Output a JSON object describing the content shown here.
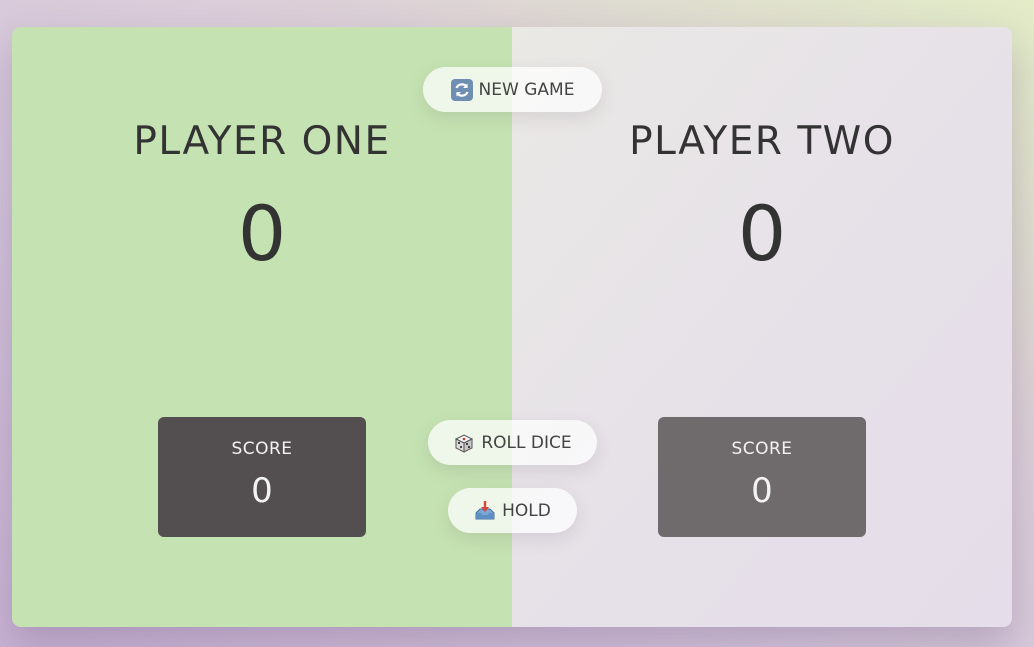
{
  "players": [
    {
      "name": "PLAYER ONE",
      "total_score": "0",
      "current_label": "SCORE",
      "current_score": "0",
      "active": true
    },
    {
      "name": "PLAYER TWO",
      "total_score": "0",
      "current_label": "SCORE",
      "current_score": "0",
      "active": false
    }
  ],
  "controls": {
    "new_game": {
      "label": "NEW GAME",
      "icon": "refresh-icon"
    },
    "roll_dice": {
      "label": "ROLL DICE",
      "icon": "dice-icon"
    },
    "hold": {
      "label": "HOLD",
      "icon": "inbox-tray-icon"
    }
  },
  "colors": {
    "active_player_bg": "#c5e3b2",
    "inactive_player_bg": "#e6e2e9",
    "active_current_box": "#534f51",
    "inactive_current_box": "#6f6a6c"
  }
}
